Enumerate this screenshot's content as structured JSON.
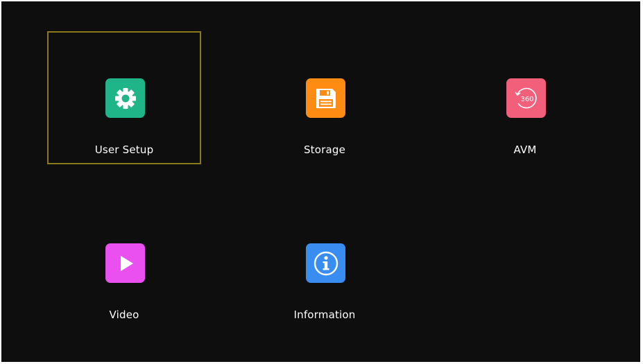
{
  "menu": {
    "items": [
      {
        "label": "User Setup",
        "icon": "gear-icon",
        "color": "#20b489",
        "selected": true
      },
      {
        "label": "Storage",
        "icon": "floppy-disk-icon",
        "color": "#ff8c12"
      },
      {
        "label": "AVM",
        "icon": "360-view-icon",
        "color": "#f25f7a",
        "icon_text": "360"
      },
      {
        "label": "Video",
        "icon": "play-icon",
        "color": "#ea4ff0"
      },
      {
        "label": "Information",
        "icon": "info-icon",
        "color": "#3a8df0"
      }
    ]
  }
}
